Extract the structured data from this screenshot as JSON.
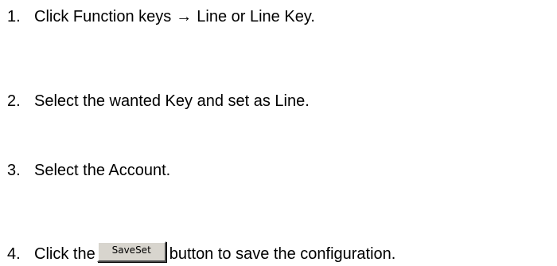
{
  "steps": [
    {
      "number": "1.",
      "text_before": "Click Function keys",
      "arrow": "→",
      "text_after": "Line or Line Key."
    },
    {
      "number": "2.",
      "text": "Select the wanted Key and set as Line."
    },
    {
      "number": "3.",
      "text": "Select the Account."
    },
    {
      "number": "4.",
      "text_before": "Click the",
      "button_label": "SaveSet",
      "text_after": "button to save the configuration."
    }
  ]
}
